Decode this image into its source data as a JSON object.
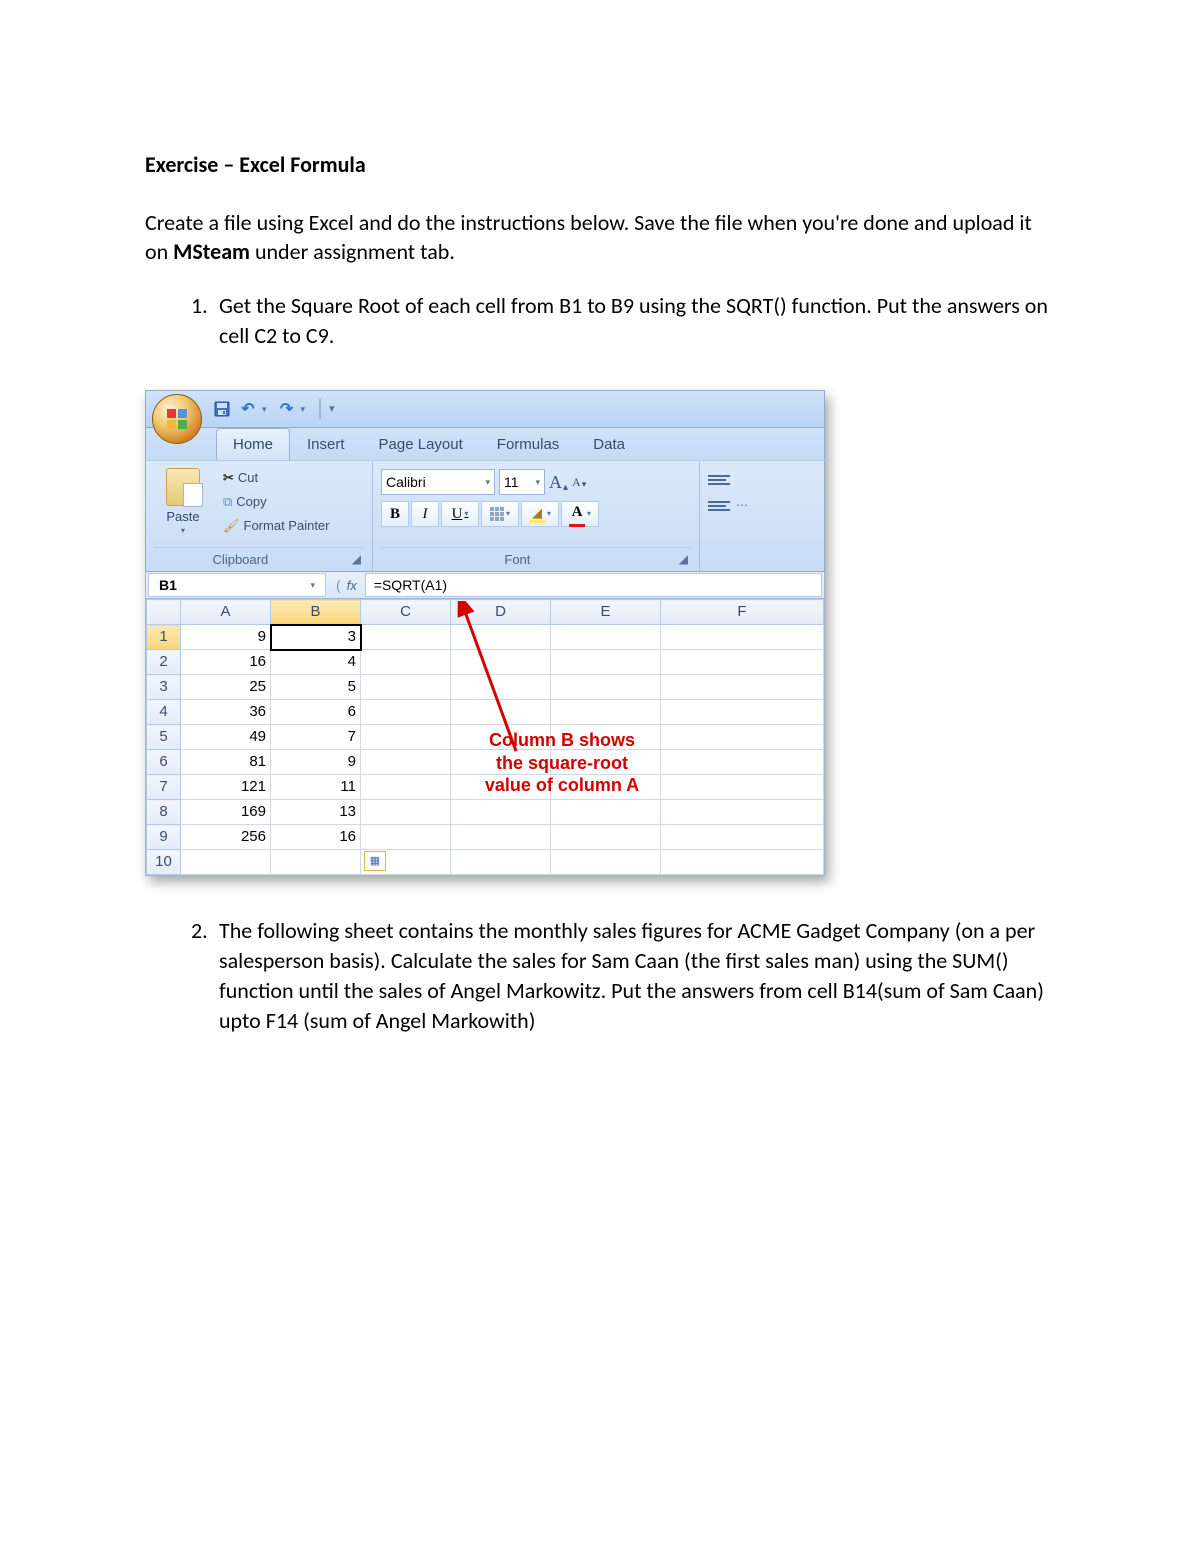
{
  "doc": {
    "title": "Exercise – Excel Formula",
    "intro_pre": "Create a file using Excel and do the instructions below. Save the file when you're done and upload it on ",
    "intro_bold": "MSteam",
    "intro_post": " under assignment tab.",
    "item1_num": "1.",
    "item1": "Get the Square Root of each cell from B1 to B9 using the SQRT() function. Put the answers on cell C2 to C9.",
    "item2_num": "2.",
    "item2": "The following sheet contains the monthly sales figures for ACME Gadget Company (on a per salesperson basis). Calculate the sales for Sam Caan (the first sales man) using the SUM() function until the sales of Angel Markowitz. Put the answers from cell B14(sum of Sam Caan) upto F14 (sum of Angel Markowith)"
  },
  "excel": {
    "tabs": [
      "Home",
      "Insert",
      "Page Layout",
      "Formulas",
      "Data"
    ],
    "active_tab": 0,
    "clipboard": {
      "paste": "Paste",
      "cut": "Cut",
      "copy": "Copy",
      "format_painter": "Format Painter",
      "group": "Clipboard"
    },
    "font": {
      "name": "Calibri",
      "size": "11",
      "group": "Font",
      "bold": "B",
      "italic": "I",
      "underline": "U",
      "fontcolor_letter": "A",
      "increase": "A",
      "decrease": "A"
    },
    "namebox": "B1",
    "fx": "fx",
    "formula": "=SQRT(A1)",
    "cols": [
      "A",
      "B",
      "C",
      "D",
      "E",
      "F"
    ],
    "rows": [
      {
        "n": "1",
        "A": "9",
        "B": "3"
      },
      {
        "n": "2",
        "A": "16",
        "B": "4"
      },
      {
        "n": "3",
        "A": "25",
        "B": "5"
      },
      {
        "n": "4",
        "A": "36",
        "B": "6"
      },
      {
        "n": "5",
        "A": "49",
        "B": "7"
      },
      {
        "n": "6",
        "A": "81",
        "B": "9"
      },
      {
        "n": "7",
        "A": "121",
        "B": "11"
      },
      {
        "n": "8",
        "A": "169",
        "B": "13"
      },
      {
        "n": "9",
        "A": "256",
        "B": "16"
      },
      {
        "n": "10",
        "A": "",
        "B": ""
      }
    ],
    "selected_cell": "B1",
    "annotation": "Column B shows\nthe square-root\nvalue of column A"
  }
}
